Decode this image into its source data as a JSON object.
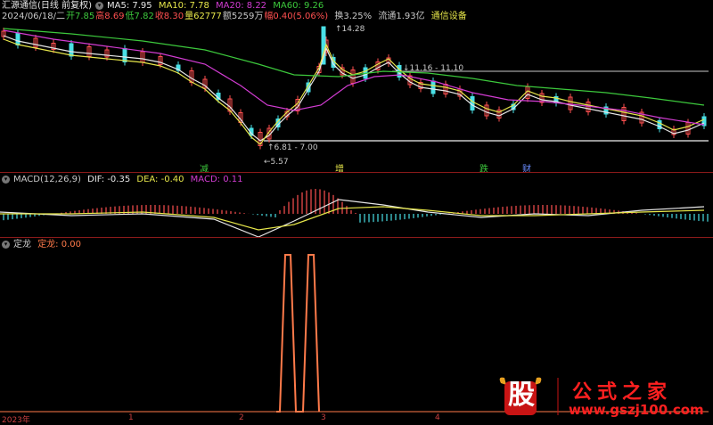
{
  "colors": {
    "ma5": "#e6e6e6",
    "ma10": "#e6e64a",
    "ma20": "#d23cd2",
    "ma60": "#3cc83c",
    "up": "#ff5050",
    "down": "#4ae0e6",
    "dif": "#e6e6e6",
    "dea": "#e6e64a",
    "signal": "#ff7a4a"
  },
  "header": {
    "title": "汇源通信(日线 前复权)",
    "ma5": "MA5: 7.95",
    "ma10": "MA10: 7.78",
    "ma20": "MA20: 8.22",
    "ma60": "MA60: 9.26"
  },
  "quote": {
    "date": "2024/06/18/二",
    "open": "开7.85",
    "high": "高8.69",
    "low": "低7.82",
    "close": "收8.30",
    "vol": "量62777",
    "amount": "额5259万",
    "change": "幅0.40(5.06%)",
    "turnover": "换3.25%",
    "float": "流通1.93亿",
    "sector": "通信设备"
  },
  "annotations": {
    "high_price": "14.28",
    "resistance": "11.16 - 11.10",
    "support": "6.81 - 7.00",
    "low_price": "5.57"
  },
  "markers": [
    {
      "text": "减",
      "color": "#3cc83c"
    },
    {
      "text": "增",
      "color": "#e6e64a"
    },
    {
      "text": "跌",
      "color": "#3cc83c"
    },
    {
      "text": "财",
      "color": "#6a8cff"
    }
  ],
  "macd_header": {
    "title": "MACD(12,26,9)",
    "dif": "DIF: -0.35",
    "dea": "DEA: -0.40",
    "macd": "MACD: 0.11"
  },
  "indicator_header": {
    "title": "定龙",
    "value": "定龙: 0.00"
  },
  "axis": {
    "labels": [
      "2023年",
      "1",
      "2",
      "3",
      "4"
    ]
  },
  "watermark": {
    "logo_char": "股",
    "name": "公式之家",
    "url": "www.gszj100.com"
  }
}
